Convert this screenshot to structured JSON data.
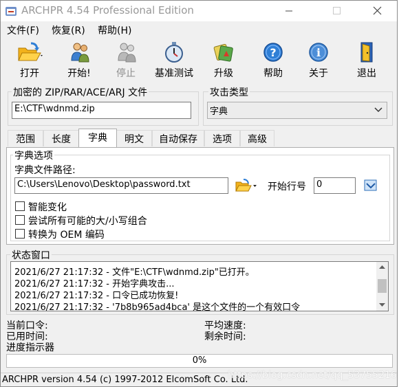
{
  "window": {
    "title": "ARCHPR 4.54 Professional Edition"
  },
  "menu": [
    {
      "label": "文件(F)"
    },
    {
      "label": "恢复(R)"
    },
    {
      "label": "帮助(H)"
    }
  ],
  "toolbar": {
    "open": "打开",
    "start": "开始!",
    "stop": "停止",
    "benchmark": "基准测试",
    "upgrade": "升级",
    "help": "帮助",
    "about": "关于",
    "exit": "退出"
  },
  "encrypted_file": {
    "label": "加密的 ZIP/RAR/ACE/ARJ 文件",
    "value": "E:\\CTF\\wdnmd.zip"
  },
  "attack_type": {
    "label": "攻击类型",
    "value": "字典"
  },
  "tabs": [
    {
      "label": "范围"
    },
    {
      "label": "长度"
    },
    {
      "label": "字典"
    },
    {
      "label": "明文"
    },
    {
      "label": "自动保存"
    },
    {
      "label": "选项"
    },
    {
      "label": "高级"
    }
  ],
  "dictionary": {
    "group_label": "字典选项",
    "path_label": "字典文件路径:",
    "path_value": "C:\\Users\\Lenovo\\Desktop\\password.txt",
    "start_line_label": "开始行号",
    "start_line_value": "0",
    "options": [
      {
        "label": "智能变化",
        "checked": false
      },
      {
        "label": "尝试所有可能的大/小写组合",
        "checked": false
      },
      {
        "label": "转换为 OEM 编码",
        "checked": false
      }
    ]
  },
  "status_window": {
    "label": "状态窗口",
    "lines": [
      "2021/6/27 21:17:32 - 文件\"E:\\CTF\\wdnmd.zip\"已打开。",
      "2021/6/27 21:17:32 - 开始字典攻击...",
      "2021/6/27 21:17:32 - 口令已成功恢复!",
      "2021/6/27 21:17:32 - '7b8b965ad4bca' 是这个文件的一个有效口令"
    ]
  },
  "stats": {
    "current_password": "当前口令:",
    "average_speed": "平均速度:",
    "elapsed_time": "已用时间:",
    "remaining_time": "剩余时间:",
    "progress_label": "进度指示器"
  },
  "progress": {
    "value": 0,
    "text": "0%"
  },
  "statusbar": {
    "text": "ARCHPR version 4.54 (c) 1997-2012 ElcomSoft Co. Ltd."
  },
  "watermark": "https://blog.csdn.net/qq_53755216"
}
